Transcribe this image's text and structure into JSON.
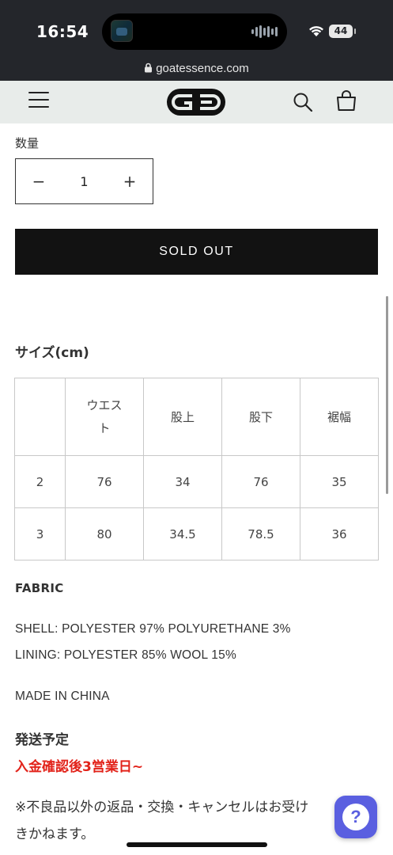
{
  "status_bar": {
    "time": "16:54",
    "battery": "44"
  },
  "browser": {
    "url": "goatessence.com"
  },
  "product": {
    "quantity_label": "数量",
    "quantity_value": "1",
    "minus": "−",
    "plus": "+",
    "sold_out_label": "SOLD OUT"
  },
  "size_chart": {
    "title": "サイズ(cm)",
    "headers": [
      "",
      "ウエスト",
      "股上",
      "股下",
      "裾幅"
    ],
    "rows": [
      [
        "2",
        "76",
        "34",
        "76",
        "35"
      ],
      [
        "3",
        "80",
        "34.5",
        "78.5",
        "36"
      ]
    ]
  },
  "fabric": {
    "title": "FABRIC",
    "shell": "SHELL: POLYESTER 97% POLYURETHANE 3%",
    "lining": "LINING: POLYESTER 85% WOOL 15%",
    "origin": "MADE IN CHINA"
  },
  "shipping": {
    "title": "発送予定",
    "highlight": "入金確認後3営業日~",
    "note_line1": "※不良品以外の返品・交換・キャンセルはお受け",
    "note_line2": "きかねます。"
  },
  "help": {
    "label": "?"
  },
  "colors": {
    "accent_red": "#e2231a",
    "header_bg": "#e8ecea",
    "button_black": "#121212",
    "help_purple": "#5a5fe0"
  },
  "icons": [
    "wifi-icon",
    "lock-icon",
    "menu-icon",
    "logo",
    "search-icon",
    "cart-icon",
    "help-icon"
  ]
}
